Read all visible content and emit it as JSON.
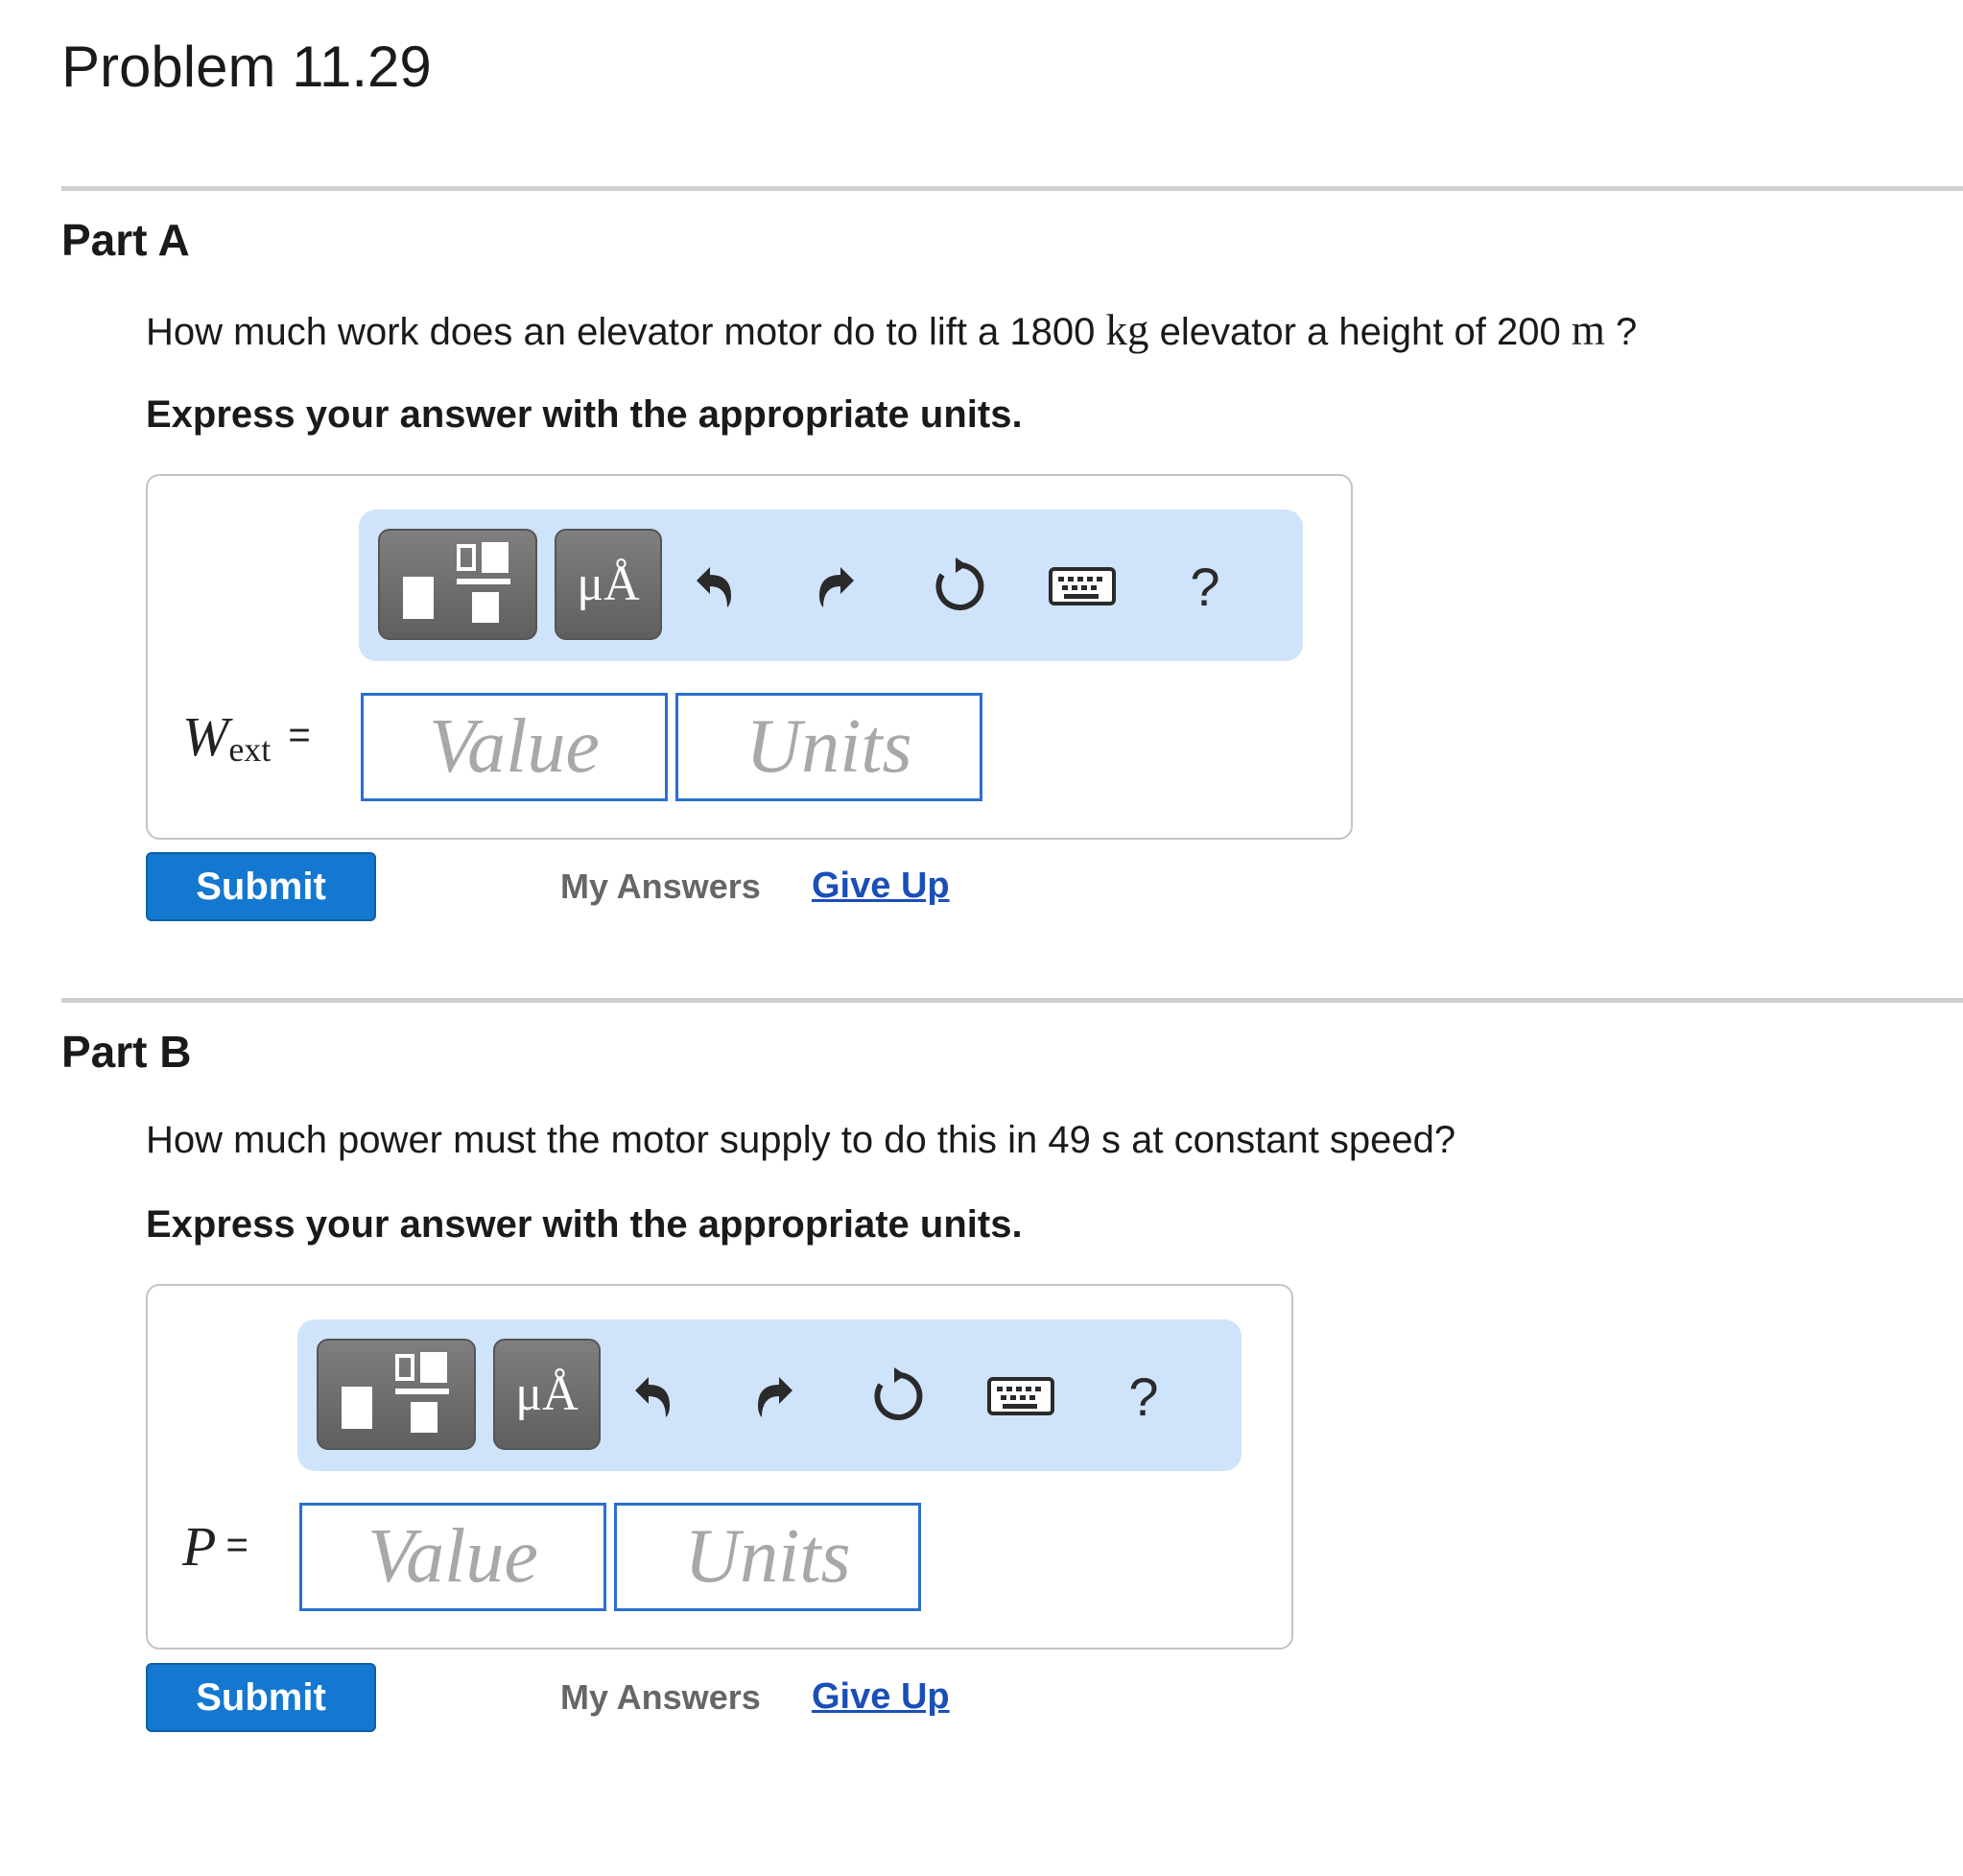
{
  "problem": {
    "title": "Problem 11.29"
  },
  "parts": [
    {
      "title": "Part A",
      "question": {
        "before": "How much work does an elevator motor do to lift a 1800 ",
        "unit1": "kg",
        "middle": " elevator a height of 200 ",
        "unit2": "m",
        "after": " ?"
      },
      "instruction": "Express your answer with the appropriate units.",
      "variable": {
        "symbol": "W",
        "subscript": "ext",
        "equals": "="
      },
      "value_placeholder": "Value",
      "units_placeholder": "Units",
      "units_button": "μÅ",
      "help": "?",
      "submit": "Submit",
      "my_answers": "My Answers",
      "give_up": "Give Up"
    },
    {
      "title": "Part B",
      "question": {
        "text": "How much power must the motor supply to do this in 49 s at constant speed?"
      },
      "instruction": "Express your answer with the appropriate units.",
      "variable": {
        "symbol": "P",
        "equals": "="
      },
      "value_placeholder": "Value",
      "units_placeholder": "Units",
      "units_button": "μÅ",
      "help": "?",
      "submit": "Submit",
      "my_answers": "My Answers",
      "give_up": "Give Up"
    }
  ]
}
